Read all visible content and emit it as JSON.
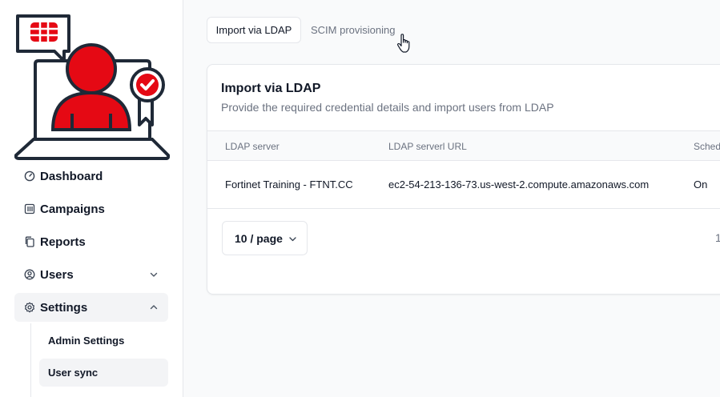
{
  "sidebar": {
    "items": [
      {
        "label": "Dashboard",
        "icon": "speedometer-icon"
      },
      {
        "label": "Campaigns",
        "icon": "bars-icon"
      },
      {
        "label": "Reports",
        "icon": "copy-icon"
      },
      {
        "label": "Users",
        "icon": "user-circle-icon",
        "expandable": true,
        "expanded": false
      },
      {
        "label": "Settings",
        "icon": "gear-icon",
        "expandable": true,
        "expanded": true
      }
    ],
    "settings_subitems": [
      {
        "label": "Admin Settings"
      },
      {
        "label": "User sync"
      }
    ]
  },
  "tabs": [
    {
      "label": "Import via LDAP",
      "active": true
    },
    {
      "label": "SCIM provisioning",
      "active": false
    }
  ],
  "card": {
    "title": "Import via LDAP",
    "subtitle": "Provide the required credential details and import users from LDAP"
  },
  "table": {
    "columns": [
      "LDAP server",
      "LDAP serverl URL",
      "Sched"
    ],
    "rows": [
      [
        "Fortinet Training - FTNT.CC",
        "ec2-54-213-136-73.us-west-2.compute.amazonaws.com",
        "On"
      ]
    ]
  },
  "pagination": {
    "page_size_label": "10 / page",
    "current_page": "1"
  },
  "colors": {
    "brand_red": "#e50914",
    "active_bg": "#f3f4f6",
    "border": "#e5e7eb",
    "muted_text": "#6b7280"
  }
}
